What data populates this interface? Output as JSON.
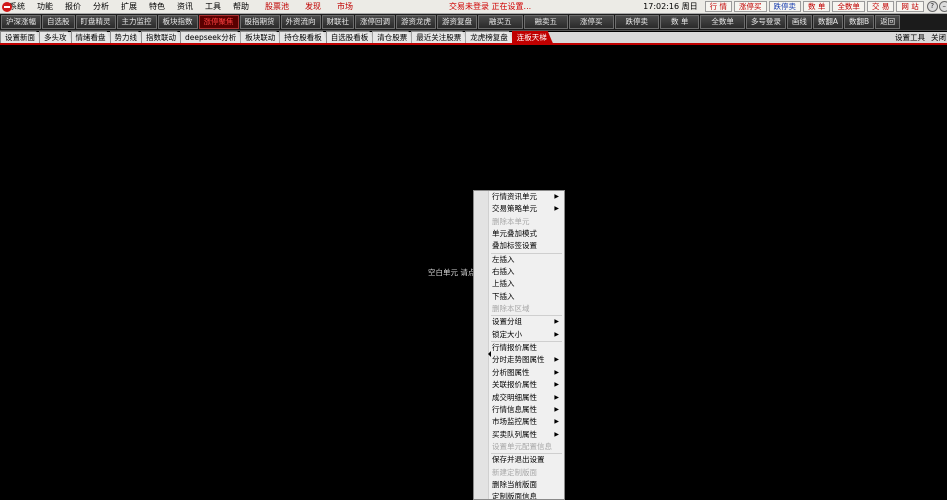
{
  "menubar": {
    "items": [
      "系统",
      "功能",
      "报价",
      "分析",
      "扩展",
      "特色",
      "资讯",
      "工具",
      "帮助"
    ],
    "special": [
      "股票池",
      "发现",
      "市场"
    ],
    "status": "交易未登录 正在设置...",
    "time": "17:02:16 周日",
    "quick_buttons": [
      "行 情",
      "涨停买",
      "跌停卖",
      "数 单",
      "全数单",
      "交 易",
      "网 站"
    ],
    "window_controls": [
      "?",
      "–",
      "□",
      "×"
    ]
  },
  "toolbar": {
    "buttons": [
      "沪深涨幅",
      "自选股",
      "盯盘精灵",
      "主力监控",
      "板块指数",
      "涨停聚焦",
      "股指期货",
      "外资流向",
      "财联社",
      "涨停回调",
      "游资龙虎",
      "游资复盘",
      "融买五",
      "融卖五",
      "涨停买",
      "跌停卖",
      "数 单",
      "全数单",
      "多号登录",
      "画线",
      "数翻A",
      "数翻B",
      "返回"
    ],
    "active_index": 5
  },
  "tabs": {
    "items": [
      "设置新面",
      "多头攻",
      "情绪看盘",
      "势力线",
      "指数联动",
      "deepseek分析",
      "板块联动",
      "持仓股看板",
      "自选股看板",
      "清仓股票",
      "最近关注股票",
      "龙虎榜复盘",
      "连板天梯"
    ],
    "active_index": 12,
    "right": [
      "设置工具",
      "关闭"
    ]
  },
  "main": {
    "empty_hint": "空白单元 请点"
  },
  "context_menu": {
    "items": [
      {
        "label": "行情资讯单元",
        "submenu": true,
        "disabled": false
      },
      {
        "label": "交易策略单元",
        "submenu": true,
        "disabled": false
      },
      {
        "label": "删除本单元",
        "submenu": false,
        "disabled": true
      },
      {
        "label": "单元叠加模式",
        "submenu": false,
        "disabled": false
      },
      {
        "label": "叠加标签设置",
        "submenu": false,
        "disabled": false
      },
      {
        "sep": true
      },
      {
        "label": "左插入",
        "submenu": false,
        "disabled": false
      },
      {
        "label": "右插入",
        "submenu": false,
        "disabled": false
      },
      {
        "label": "上插入",
        "submenu": false,
        "disabled": false
      },
      {
        "label": "下插入",
        "submenu": false,
        "disabled": false
      },
      {
        "label": "删除本区域",
        "submenu": false,
        "disabled": true
      },
      {
        "sep": true
      },
      {
        "label": "设置分组",
        "submenu": true,
        "disabled": false
      },
      {
        "label": "锁定大小",
        "submenu": true,
        "disabled": false
      },
      {
        "sep": true
      },
      {
        "label": "行情报价属性",
        "submenu": false,
        "disabled": false
      },
      {
        "label": "分时走势图属性",
        "submenu": true,
        "disabled": false
      },
      {
        "label": "分析图属性",
        "submenu": true,
        "disabled": false
      },
      {
        "label": "关联报价属性",
        "submenu": true,
        "disabled": false
      },
      {
        "label": "成交明细属性",
        "submenu": true,
        "disabled": false
      },
      {
        "label": "行情信息属性",
        "submenu": true,
        "disabled": false
      },
      {
        "label": "市场监控属性",
        "submenu": true,
        "disabled": false
      },
      {
        "label": "买卖队列属性",
        "submenu": true,
        "disabled": false
      },
      {
        "label": "设置单元配置信息",
        "submenu": false,
        "disabled": true
      },
      {
        "sep": true
      },
      {
        "label": "保存并退出设置",
        "submenu": false,
        "disabled": false
      },
      {
        "label": "新建定制版面",
        "submenu": false,
        "disabled": true
      },
      {
        "label": "删除当前版面",
        "submenu": false,
        "disabled": false
      },
      {
        "label": "定制版面信息",
        "submenu": false,
        "disabled": false
      }
    ]
  }
}
